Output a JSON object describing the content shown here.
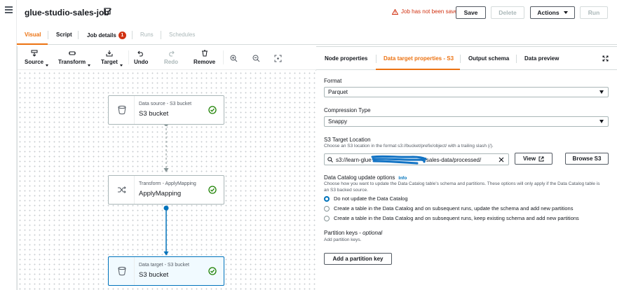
{
  "header": {
    "job_name": "glue-studio-sales-job",
    "warning": "Job has not been saved",
    "save": "Save",
    "delete": "Delete",
    "actions": "Actions",
    "run": "Run"
  },
  "main_tabs": [
    {
      "label": "Visual"
    },
    {
      "label": "Script"
    },
    {
      "label": "Job details",
      "badge": "1"
    },
    {
      "label": "Runs"
    },
    {
      "label": "Schedules"
    }
  ],
  "toolbar": {
    "source": "Source",
    "transform": "Transform",
    "target": "Target",
    "undo": "Undo",
    "redo": "Redo",
    "remove": "Remove"
  },
  "nodes": [
    {
      "subtitle": "Data source - S3 bucket",
      "name": "S3 bucket"
    },
    {
      "subtitle": "Transform - ApplyMapping",
      "name": "ApplyMapping"
    },
    {
      "subtitle": "Data target - S3 bucket",
      "name": "S3 bucket"
    }
  ],
  "panel_tabs": [
    {
      "label": "Node properties"
    },
    {
      "label": "Data target properties - S3"
    },
    {
      "label": "Output schema"
    },
    {
      "label": "Data preview"
    }
  ],
  "form": {
    "format_label": "Format",
    "format_value": "Parquet",
    "compression_label": "Compression Type",
    "compression_value": "Snappy",
    "location_label": "S3 Target Location",
    "location_desc": "Choose an S3 location in the format s3://bucket/prefix/object/ with a trailing slash (/).",
    "location_value_start": "s3://learn-glue",
    "location_value_end": "/sales-data/processed/",
    "view": "View",
    "browse": "Browse S3",
    "catalog_label": "Data Catalog update options",
    "catalog_info": "Info",
    "catalog_desc": "Choose how you want to update the Data Catalog table's schema and partitions. These options will only apply if the Data Catalog table is an S3 backed source.",
    "options": [
      "Do not update the Data Catalog",
      "Create a table in the Data Catalog and on subsequent runs, update the schema and add new partitions",
      "Create a table in the Data Catalog and on subsequent runs, keep existing schema and add new partitions"
    ],
    "partition_label": "Partition keys - ",
    "partition_optional": "optional",
    "partition_desc": "Add partition keys.",
    "add_partition": "Add a partition key"
  },
  "colors": {
    "accent": "#ec7211",
    "link": "#0073bb",
    "success": "#1d8102",
    "error": "#d13212"
  }
}
